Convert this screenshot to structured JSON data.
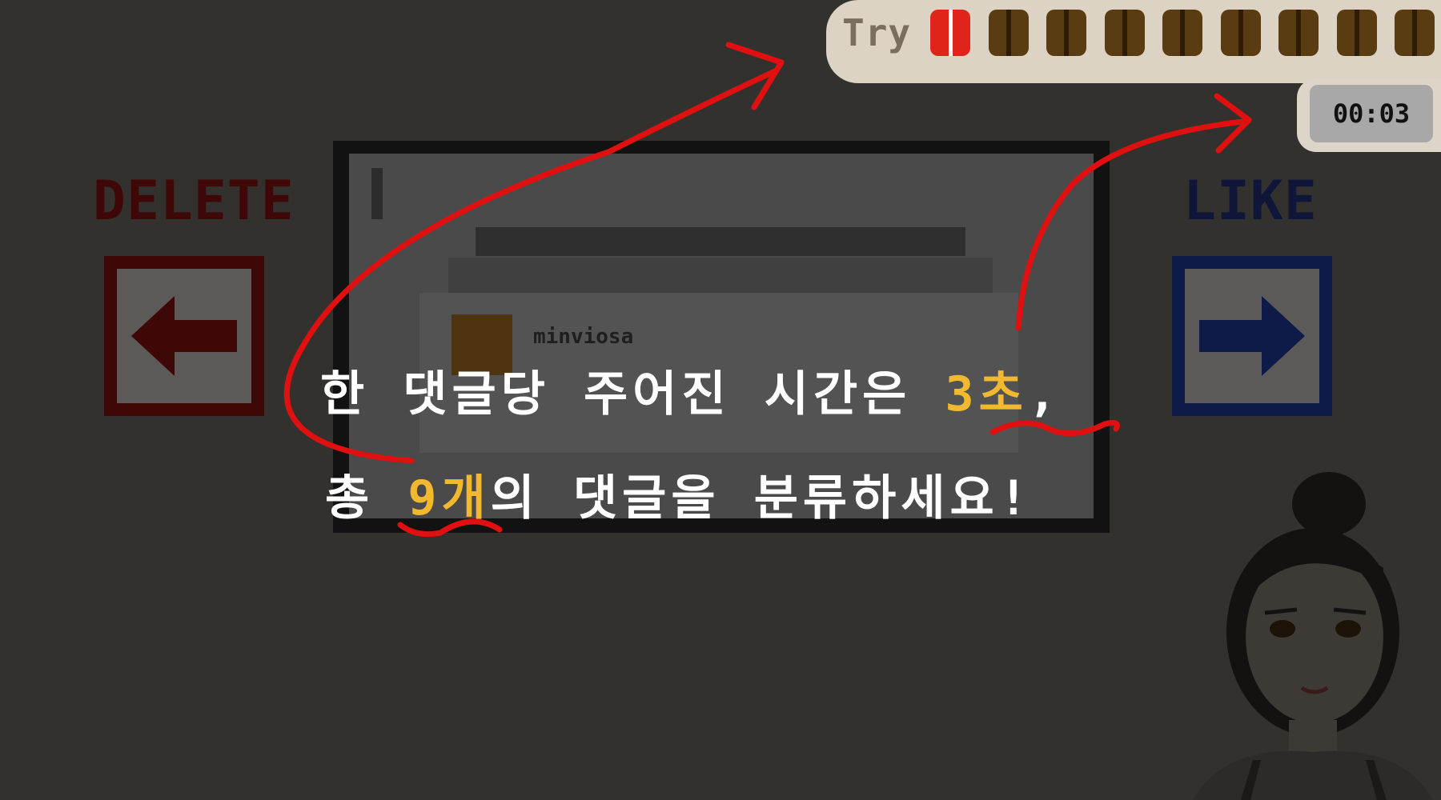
{
  "hud": {
    "try_label": "Try",
    "tokens": {
      "total": 9,
      "active_index": 0
    },
    "timer": "00:03"
  },
  "buttons": {
    "delete_label": "DELETE",
    "like_label": "LIKE"
  },
  "card": {
    "username": "minviosa"
  },
  "tutorial": {
    "line1_before": "한 댓글당 주어진 시간은 ",
    "line1_highlight": "3초",
    "line1_after": ",",
    "line2_before": "총 ",
    "line2_highlight": "9개",
    "line2_after": "의 댓글을 분류하세요!"
  },
  "colors": {
    "background": "#33312d",
    "highlight": "#f2b830",
    "annotation": "#e01010",
    "delete": "#3f0808",
    "like": "#0e1a48"
  },
  "icons": {
    "delete": "left-arrow-icon",
    "like": "right-arrow-icon"
  }
}
